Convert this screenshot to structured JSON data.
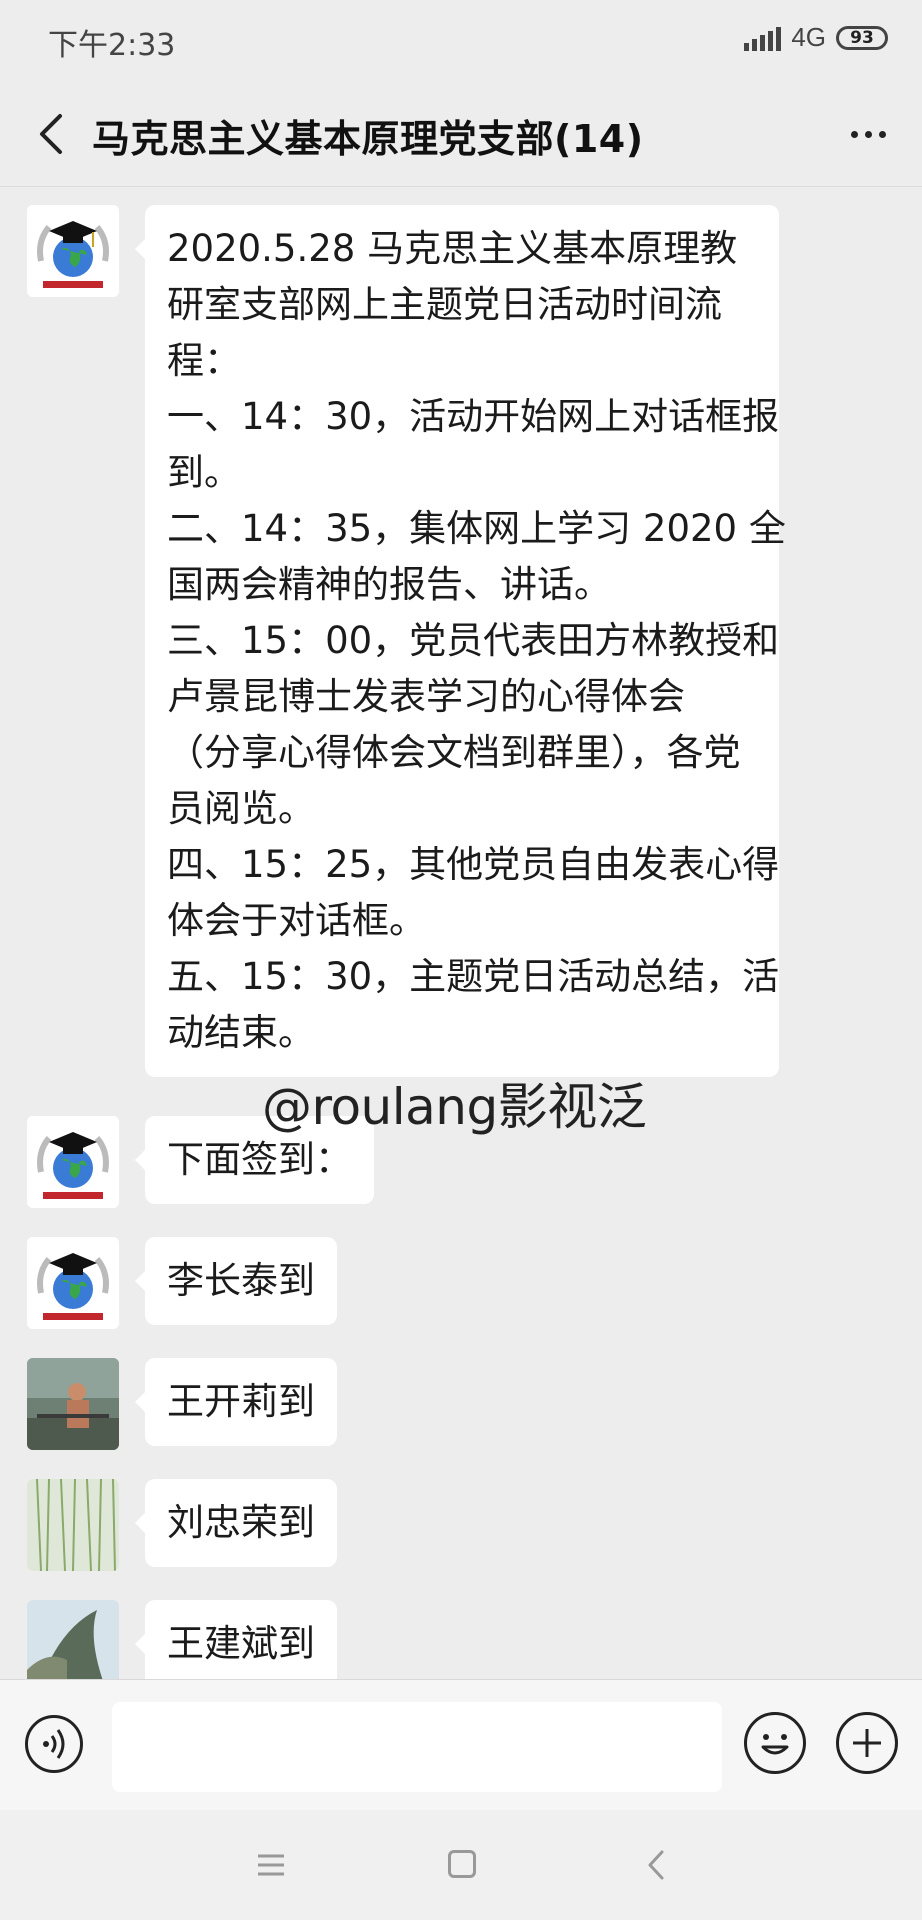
{
  "status_bar": {
    "time": "下午2:33",
    "network": "4G",
    "battery": "93"
  },
  "header": {
    "title": "马克思主义基本原理党支部(14)",
    "back_icon": "chevron-left-icon",
    "more_icon": "more-dots-icon"
  },
  "messages": [
    {
      "avatar": "university-globe-avatar",
      "lines": [
        "2020.5.28 马克思主义基本原理教",
        "研室支部网上主题党日活动时间流",
        "程：",
        "一、14：30，活动开始网上对话框报",
        "到。",
        "二、14：35，集体网上学习 2020 全",
        "国两会精神的报告、讲话。",
        "三、15：00，党员代表田方林教授和",
        "卢景昆博士发表学习的心得体会",
        "（分享心得体会文档到群里），各党",
        "员阅览。",
        "四、15：25，其他党员自由发表心得",
        "体会于对话框。",
        "五、15：30，主题党日活动总结，活",
        "动结束。"
      ]
    },
    {
      "avatar": "university-globe-avatar",
      "text": "下面签到："
    },
    {
      "avatar": "university-globe-avatar",
      "text": "李长泰到"
    },
    {
      "avatar": "man-photo-avatar",
      "text": "王开莉到"
    },
    {
      "avatar": "willow-photo-avatar",
      "text": "刘忠荣到"
    },
    {
      "avatar": "tree-photo-avatar",
      "text": "王建斌到"
    }
  ],
  "watermark": "@roulang影视泛",
  "input_bar": {
    "voice_icon": "voice-icon",
    "emoji_icon": "emoji-icon",
    "plus_icon": "plus-icon",
    "input_value": ""
  },
  "nav_bar": {
    "menu_icon": "menu-icon",
    "home_icon": "home-icon",
    "back_icon": "back-icon"
  },
  "colors": {
    "background": "#ededed",
    "bubble": "#ffffff",
    "text": "#1b1b1b"
  }
}
